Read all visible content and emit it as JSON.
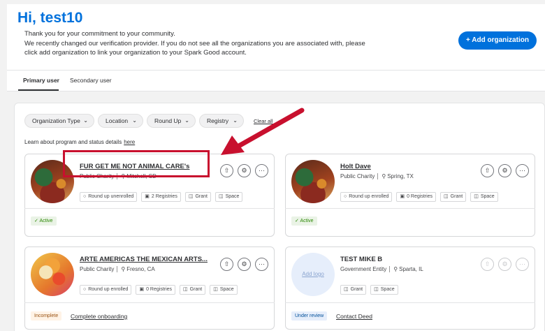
{
  "header": {
    "greeting": "Hi, test10",
    "intro_line1": "Thank you for your commitment to your community.",
    "intro_line2": "We recently changed our verification provider. If you do not see all the organizations you are associated with, please",
    "intro_line3": "click add organization to link your organization to your Spark Good account.",
    "add_org_label": "+ Add organization"
  },
  "tabs": [
    {
      "label": "Primary user",
      "active": true
    },
    {
      "label": "Secondary user",
      "active": false
    }
  ],
  "filters": {
    "items": [
      "Organization Type",
      "Location",
      "Round Up",
      "Registry"
    ],
    "clear_label": "Clear all"
  },
  "learn": {
    "text": "Learn about program and status details",
    "link": "here"
  },
  "cards": [
    {
      "name": "FUR GET ME NOT ANIMAL CARE's",
      "type": "Public Charity",
      "location": "Mitchell, SD",
      "chips": [
        "Round up unenrolled",
        "2 Registries",
        "Grant",
        "Space"
      ],
      "status": "Active",
      "status_link": ""
    },
    {
      "name": "Holt Dave",
      "type": "Public Charity",
      "location": "Spring, TX",
      "chips": [
        "Round up enrolled",
        "0 Registries",
        "Grant",
        "Space"
      ],
      "status": "Active",
      "status_link": ""
    },
    {
      "name": "ARTE AMERICAS THE MEXICAN ARTS...",
      "type": "Public Charity",
      "location": "Fresno, CA",
      "chips": [
        "Round up enrolled",
        "0 Registries",
        "Grant",
        "Space"
      ],
      "status": "Incomplete",
      "status_link": "Complete onboarding"
    },
    {
      "name": "TEST MIKE B",
      "type": "Government Entity",
      "location": "Sparta, IL",
      "logo_placeholder": "Add logo",
      "chips": [
        "Grant",
        "Space"
      ],
      "status": "Under review",
      "status_link": "Contact Deed"
    }
  ],
  "colors": {
    "brand_blue": "#0071dc",
    "highlight_red": "#c8102e"
  }
}
